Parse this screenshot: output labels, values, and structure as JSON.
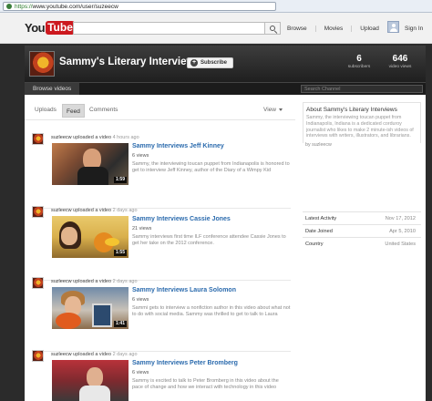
{
  "browser": {
    "url_scheme": "https://",
    "url_rest": "www.youtube.com/user/suzeecw"
  },
  "masthead": {
    "logo_you": "You",
    "logo_tube": "Tube",
    "search_placeholder": "",
    "nav": [
      "Browse",
      "Movies",
      "Upload"
    ],
    "signin": "Sign In"
  },
  "channel": {
    "title": "Sammy's Literary Interviews",
    "subscribe_label": "Subscribe",
    "subscribers_count": "6",
    "subscribers_label": "subscribers",
    "views_count": "646",
    "views_label": "video views",
    "browse_videos": "Browse videos",
    "search_placeholder": "Search Channel"
  },
  "feed": {
    "tabs": [
      "Uploads",
      "Feed",
      "Comments"
    ],
    "view_label": "View",
    "items": [
      {
        "user": "suzleecw",
        "action": " uploaded a video ",
        "ago": "4 hours ago",
        "title": "Sammy Interviews Jeff Kinney",
        "views": "6 views",
        "description": "Sammy, the interviewing toucan puppet from Indianapolis is honored to get to interview Jeff Kinney, author of the Diary of a Wimpy Kid",
        "duration": "1:59"
      },
      {
        "user": "suzleecw",
        "action": " uploaded a video ",
        "ago": "2 days ago",
        "title": "Sammy Interviews Cassie Jones",
        "views": "21 views",
        "description": "Sammy interviews first time ILF conference attendee Cassie Jones to get her take on the 2012 conference.",
        "duration": "1:55"
      },
      {
        "user": "suzleecw",
        "action": " uploaded a video ",
        "ago": "2 days ago",
        "title": "Sammy Interviews Laura Solomon",
        "views": "6 views",
        "description": "Sammi gets to interview a nonfiction author in this video about what not to do with social media. Sammy was thrilled to get to talk to Laura",
        "duration": "1:41"
      },
      {
        "user": "suzleecw",
        "action": " uploaded a video ",
        "ago": "2 days ago",
        "title": "Sammy Interviews Peter Bromberg",
        "views": "6 views",
        "description": "Sammy is excited to talk to Peter Bromberg in this video about the pace of change and how we interact with technology in this video",
        "duration": ""
      }
    ]
  },
  "sidebar": {
    "about_title": "About Sammy's Literary Interviews",
    "about_text": "Sammy, the interviewing toucan puppet from Indianapolis, Indiana is a dedicated corduroy journalist who likes to make 2 minute-ish videos of interviews with writers, illustrators, and librarians.",
    "by": "by suzleecw",
    "rows": [
      {
        "key": "Latest Activity",
        "value": "Nov 17, 2012"
      },
      {
        "key": "Date Joined",
        "value": "Apr 5, 2010"
      },
      {
        "key": "Country",
        "value": "United States"
      }
    ]
  },
  "colors": {
    "youtube_red": "#cc181e",
    "link_blue": "#2a6aad",
    "banner_dark": "#2b2b2b"
  }
}
